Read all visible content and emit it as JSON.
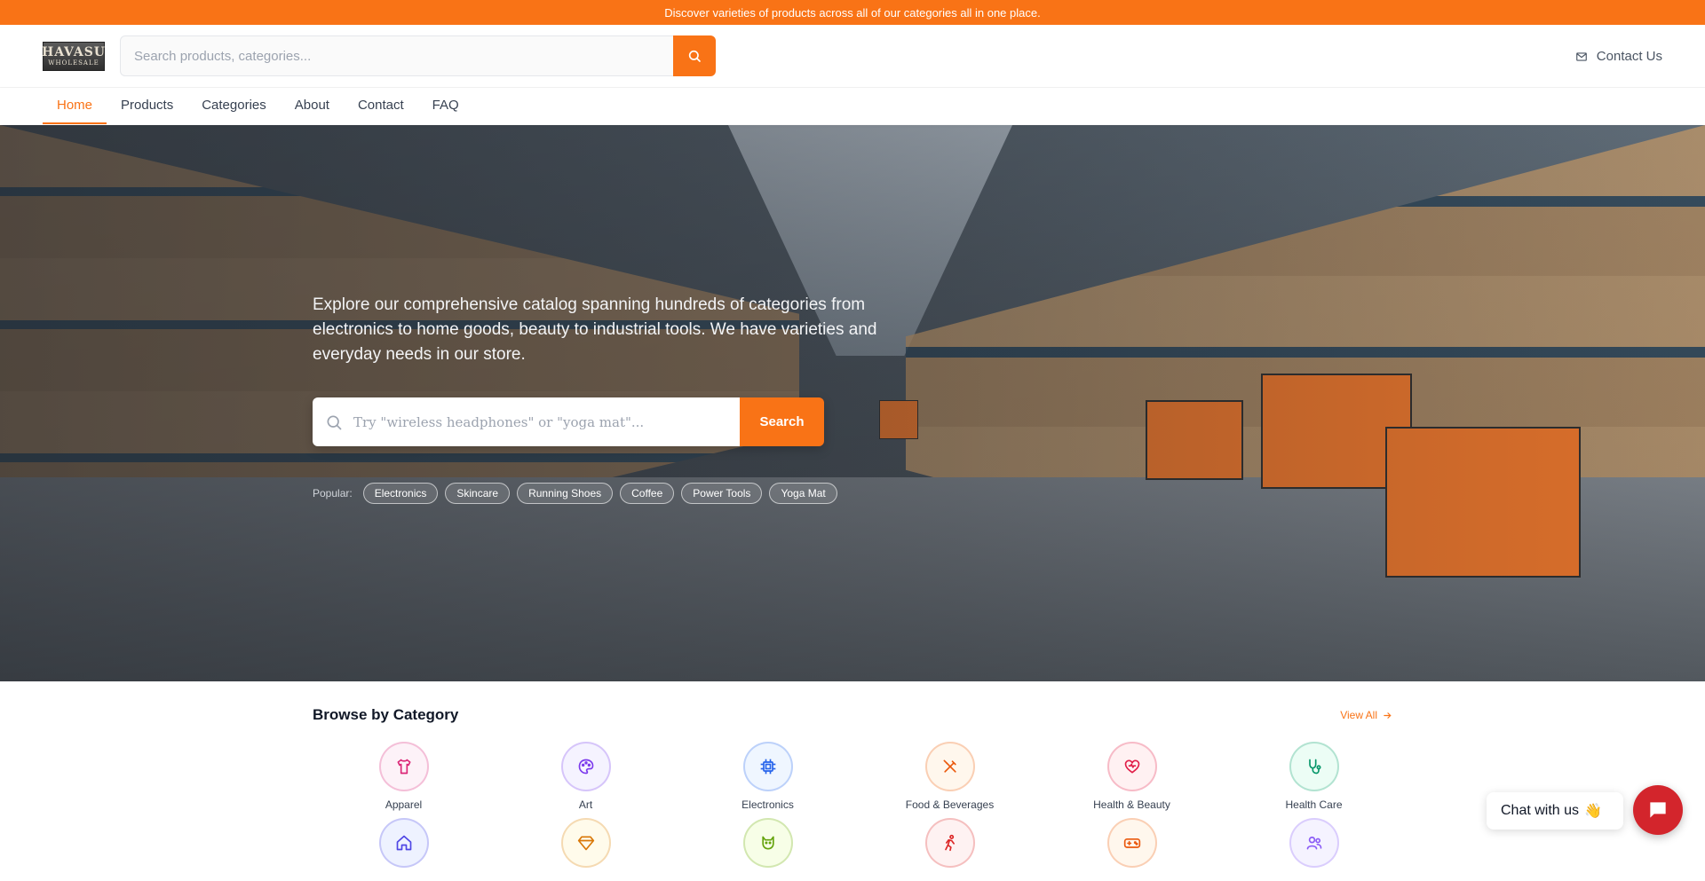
{
  "announcement": "Discover varieties  of products across  all of our categories all in one place.",
  "brand": {
    "logo_line1": "HAVASU",
    "logo_line2": "WHOLESALE"
  },
  "header": {
    "search_placeholder": "Search products, categories...",
    "contact_label": "Contact Us"
  },
  "nav": {
    "items": [
      {
        "label": "Home",
        "active": true
      },
      {
        "label": "Products"
      },
      {
        "label": "Categories"
      },
      {
        "label": "About"
      },
      {
        "label": "Contact"
      },
      {
        "label": "FAQ"
      }
    ]
  },
  "hero": {
    "text": "Explore our comprehensive catalog spanning hundreds of categories from electronics to home goods, beauty to industrial tools. We have varieties and everyday needs in our store.",
    "search_placeholder": "Try \"wireless headphones\" or \"yoga mat\"...",
    "search_button": "Search",
    "popular_label": "Popular:",
    "popular": [
      "Electronics",
      "Skincare",
      "Running Shoes",
      "Coffee",
      "Power Tools",
      "Yoga Mat"
    ]
  },
  "categories": {
    "title": "Browse by Category",
    "view_all": "View All",
    "items": [
      {
        "label": "Apparel",
        "icon": "shirt-icon",
        "color": "#db2777",
        "bg": "#fdf2f8"
      },
      {
        "label": "Art",
        "icon": "palette-icon",
        "color": "#7c3aed",
        "bg": "#f5f3ff"
      },
      {
        "label": "Electronics",
        "icon": "chip-icon",
        "color": "#2563eb",
        "bg": "#eff6ff"
      },
      {
        "label": "Food & Beverages",
        "icon": "utensils-icon",
        "color": "#ea580c",
        "bg": "#fff7ed"
      },
      {
        "label": "Health & Beauty",
        "icon": "heart-pulse-icon",
        "color": "#e11d48",
        "bg": "#fff1f2"
      },
      {
        "label": "Health Care",
        "icon": "stethoscope-icon",
        "color": "#059669",
        "bg": "#ecfdf5"
      },
      {
        "label": "",
        "icon": "home-icon",
        "color": "#4f46e5",
        "bg": "#eef2ff"
      },
      {
        "label": "",
        "icon": "gem-icon",
        "color": "#d97706",
        "bg": "#fffbeb"
      },
      {
        "label": "",
        "icon": "pet-icon",
        "color": "#65a30d",
        "bg": "#f7fee7"
      },
      {
        "label": "",
        "icon": "running-icon",
        "color": "#dc2626",
        "bg": "#fef2f2"
      },
      {
        "label": "",
        "icon": "gamepad-icon",
        "color": "#ea580c",
        "bg": "#fff7ed"
      },
      {
        "label": "",
        "icon": "users-icon",
        "color": "#8b5cf6",
        "bg": "#f5f3ff"
      }
    ]
  },
  "chat": {
    "label": "Chat with us",
    "emoji": "👋"
  },
  "colors": {
    "accent": "#f97316",
    "chat": "#d3252c"
  }
}
